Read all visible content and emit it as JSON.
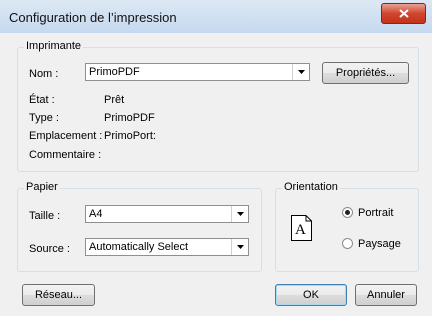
{
  "window": {
    "title": "Configuration de l’impression"
  },
  "printer": {
    "group_label": "Imprimante",
    "name_label": "Nom :",
    "name_value": "PrimoPDF",
    "properties_button": "Propriétés...",
    "status_label": "État :",
    "status_value": "Prêt",
    "type_label": "Type :",
    "type_value": "PrimoPDF",
    "location_label": "Emplacement :",
    "location_value": "PrimoPort:",
    "comment_label": "Commentaire :"
  },
  "paper": {
    "group_label": "Papier",
    "size_label": "Taille :",
    "size_value": "A4",
    "source_label": "Source :",
    "source_value": "Automatically Select"
  },
  "orientation": {
    "group_label": "Orientation",
    "icon_letter": "A",
    "portrait_label": "Portrait",
    "landscape_label": "Paysage",
    "selected": "Portrait"
  },
  "footer": {
    "network_button": "Réseau...",
    "ok_button": "OK",
    "cancel_button": "Annuler"
  },
  "icons": {
    "close": "close-icon",
    "dropdown": "chevron-down-icon",
    "orientation": "portrait-page-icon"
  },
  "colors": {
    "close_button": "#c4321b",
    "dialog_background": "#f0f0f0",
    "default_button_border": "#3c7fb1"
  }
}
